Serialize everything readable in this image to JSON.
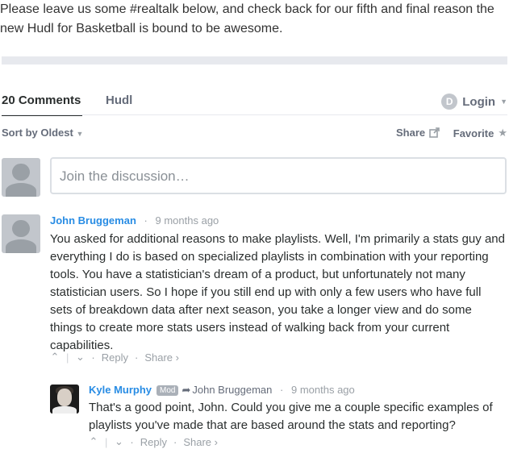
{
  "intro": {
    "text": "Please leave us some #realtalk below, and check back for our fifth and final reason the new Hudl for Basketball is bound to be awesome."
  },
  "tabs": {
    "comments_label": "20 Comments",
    "forum_label": "Hudl",
    "login_label": "Login",
    "login_icon_letter": "D"
  },
  "sortbar": {
    "sort_label": "Sort by Oldest",
    "share_label": "Share",
    "favorite_label": "Favorite"
  },
  "composer": {
    "placeholder": "Join the discussion…"
  },
  "comments": [
    {
      "author": "John Bruggeman",
      "time": "9 months ago",
      "body": "You asked for additional reasons to make playlists. Well, I'm primarily a stats guy and everything I do is based on specialized playlists in combination with your reporting tools. You have a statistician's dream of a product, but unfortunately not many statistician users. So I hope if you still end up with only a few users who have full sets of breakdown data after next season, you take a longer view and do some things to create more stats users instead of walking back from your current capabilities.",
      "reply_label": "Reply",
      "share_label": "Share ›"
    },
    {
      "author": "Kyle Murphy",
      "badge": "Mod",
      "in_reply_to": "John Bruggeman",
      "time": "9 months ago",
      "body": "That's a good point, John. Could you give me a couple specific examples of playlists you've made that are based around the stats and reporting?",
      "reply_label": "Reply",
      "share_label": "Share ›"
    }
  ],
  "colors": {
    "accent_link": "#288ce4",
    "muted": "#656c7a",
    "divider": "#e7e9ee"
  }
}
